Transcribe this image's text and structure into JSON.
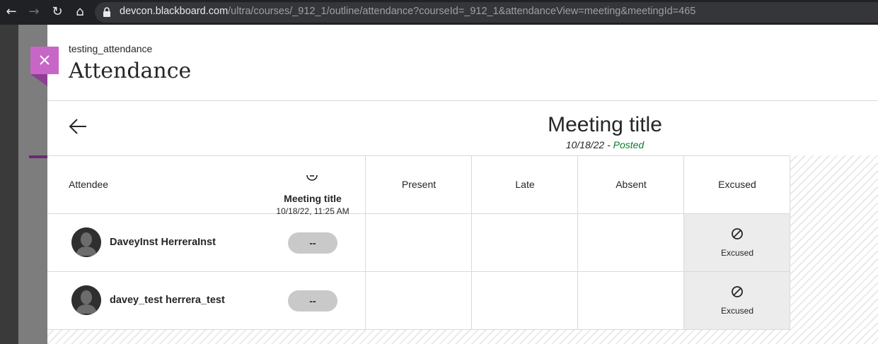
{
  "browser": {
    "url_host": "devcon.blackboard.com",
    "url_path": "/ultra/courses/_912_1/outline/attendance?courseId=_912_1&attendanceView=meeting&meetingId=465"
  },
  "header": {
    "course_name": "testing_attendance",
    "page_title": "Attendance"
  },
  "meeting": {
    "title": "Meeting title",
    "date": "10/18/22",
    "separator": " - ",
    "status": "Posted"
  },
  "table": {
    "attendee_header": "Attendee",
    "meeting_column": {
      "title": "Meeting title",
      "datetime": "10/18/22, 11:25 AM"
    },
    "status_columns": [
      "Present",
      "Late",
      "Absent",
      "Excused"
    ],
    "rows": [
      {
        "name": "DaveyInst HerreraInst",
        "grade": "--",
        "status": "Excused"
      },
      {
        "name": "davey_test herrera_test",
        "grade": "--",
        "status": "Excused"
      }
    ]
  },
  "colors": {
    "close_button": "#c866c8",
    "posted": "#0d7a2c",
    "excused_cell": "#ececec"
  }
}
